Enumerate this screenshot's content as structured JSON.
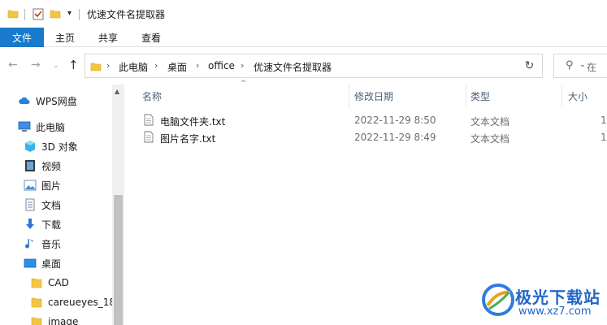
{
  "window": {
    "title": "优速文件名提取器"
  },
  "ribbon": {
    "tabs": [
      {
        "label": "文件"
      },
      {
        "label": "主页"
      },
      {
        "label": "共享"
      },
      {
        "label": "查看"
      }
    ]
  },
  "address": {
    "breadcrumbs": [
      "此电脑",
      "桌面",
      "office",
      "优速文件名提取器"
    ],
    "search_placeholder": "在"
  },
  "navpane": {
    "items": [
      {
        "label": "WPS网盘",
        "icon": "cloud-icon"
      },
      {
        "label": "此电脑",
        "icon": "computer-icon"
      },
      {
        "label": "3D 对象",
        "icon": "3d-objects-icon"
      },
      {
        "label": "视频",
        "icon": "video-icon"
      },
      {
        "label": "图片",
        "icon": "pictures-icon"
      },
      {
        "label": "文档",
        "icon": "documents-icon"
      },
      {
        "label": "下载",
        "icon": "download-icon"
      },
      {
        "label": "音乐",
        "icon": "music-icon"
      },
      {
        "label": "桌面",
        "icon": "desktop-icon"
      },
      {
        "label": "CAD",
        "icon": "folder-icon"
      },
      {
        "label": "careueyes_18",
        "icon": "folder-icon"
      },
      {
        "label": "image",
        "icon": "folder-icon"
      }
    ]
  },
  "files": {
    "columns": [
      {
        "label": "名称"
      },
      {
        "label": "修改日期"
      },
      {
        "label": "类型"
      },
      {
        "label": "大小"
      }
    ],
    "rows": [
      {
        "name": "电脑文件夹.txt",
        "modified": "2022-11-29 8:50",
        "type": "文本文档",
        "size": "1"
      },
      {
        "name": "图片名字.txt",
        "modified": "2022-11-29 8:49",
        "type": "文本文档",
        "size": "1"
      }
    ]
  },
  "watermark": {
    "brand": "极光下载站",
    "url": "www.xz7.com"
  },
  "colors": {
    "accent": "#1979ca",
    "folder": "#f4c542",
    "header_text": "#4c607a"
  }
}
